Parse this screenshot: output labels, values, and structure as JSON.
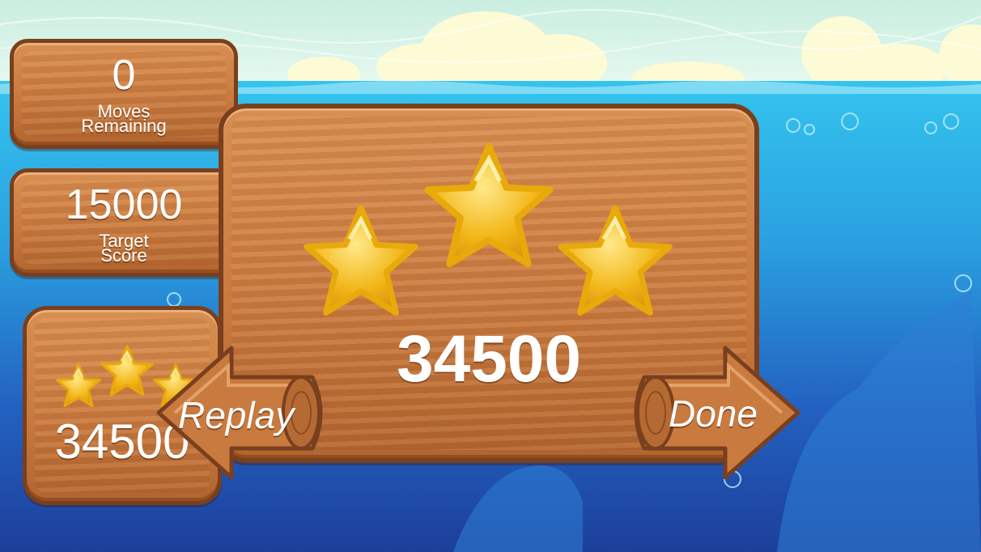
{
  "hud": {
    "moves": {
      "value": "0",
      "label_line1": "Moves",
      "label_line2": "Remaining"
    },
    "target": {
      "value": "15000",
      "label_line1": "Target",
      "label_line2": "Score"
    },
    "mini_score": {
      "value": "34500",
      "stars_earned": 3,
      "stars_total": 3
    }
  },
  "result": {
    "score": "34500",
    "stars_earned": 3,
    "stars_total": 3,
    "replay_label": "Replay",
    "done_label": "Done"
  },
  "colors": {
    "sky": "#d9f3e8",
    "water_top": "#2fb6e6",
    "water_deep": "#1d3f9a",
    "wood": "#cf8247",
    "wood_outline": "#7a3f1d",
    "star_gold": "#f2b71a"
  }
}
